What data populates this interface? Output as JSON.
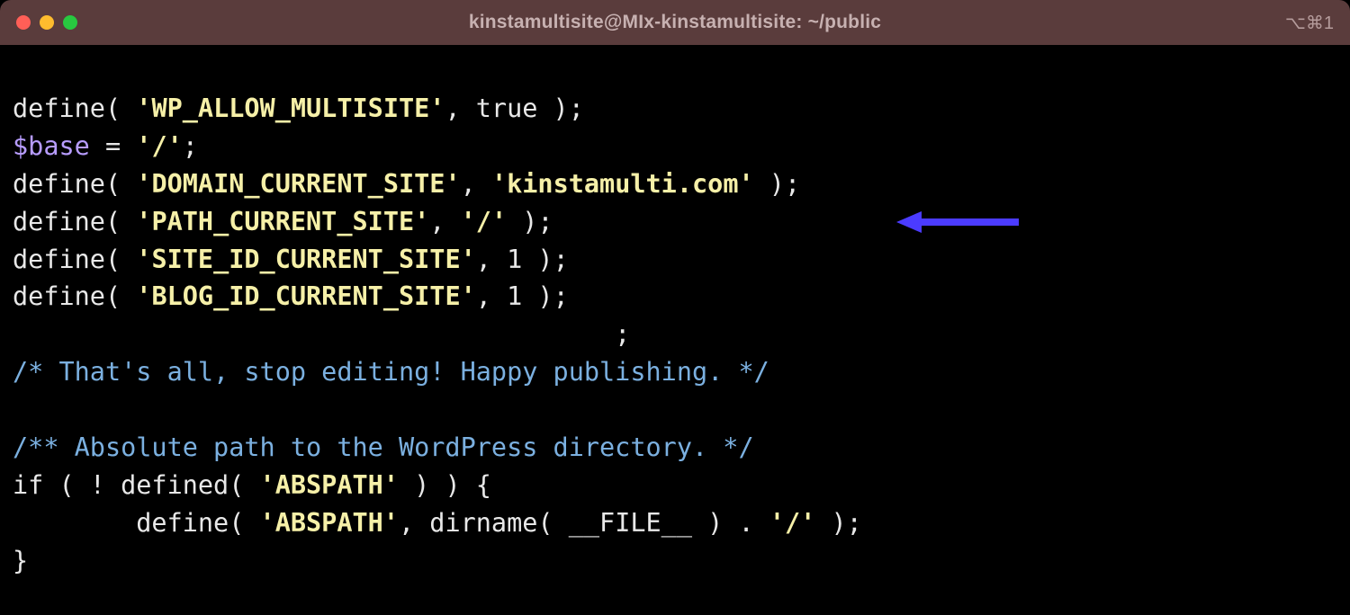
{
  "titlebar": {
    "title": "kinstamultisite@MIx-kinstamultisite: ~/public",
    "shortcut": "⌥⌘1"
  },
  "code": {
    "l1_def": "define( ",
    "l1_str": "'WP_ALLOW_MULTISITE'",
    "l1_rest": ", true );",
    "l2_var": "$base",
    "l2_eq": " = ",
    "l2_str": "'/'",
    "l2_semi": ";",
    "l3_def": "define( ",
    "l3_str1": "'DOMAIN_CURRENT_SITE'",
    "l3_comma": ", ",
    "l3_str2": "'kinstamulti.com'",
    "l3_rest": " );",
    "l4_def": "define( ",
    "l4_str1": "'PATH_CURRENT_SITE'",
    "l4_comma": ", ",
    "l4_str2": "'/'",
    "l4_rest": " );",
    "l5_def": "define( ",
    "l5_str": "'SITE_ID_CURRENT_SITE'",
    "l5_rest": ", 1 );",
    "l6_def": "define( ",
    "l6_str": "'BLOG_ID_CURRENT_SITE'",
    "l6_rest": ", 1 );",
    "l7": "                                       ;",
    "l8_comment": "/* That's all, stop editing! Happy publishing. */",
    "l9": "",
    "l10_comment": "/** Absolute path to the WordPress directory. */",
    "l11_a": "if ( ! defined( ",
    "l11_str": "'ABSPATH'",
    "l11_b": " ) ) {",
    "l12_a": "        define( ",
    "l12_str1": "'ABSPATH'",
    "l12_b": ", dirname( ",
    "l12_magic": "__FILE__",
    "l12_c": " ) . ",
    "l12_str2": "'/'",
    "l12_d": " );",
    "l13": "}"
  }
}
